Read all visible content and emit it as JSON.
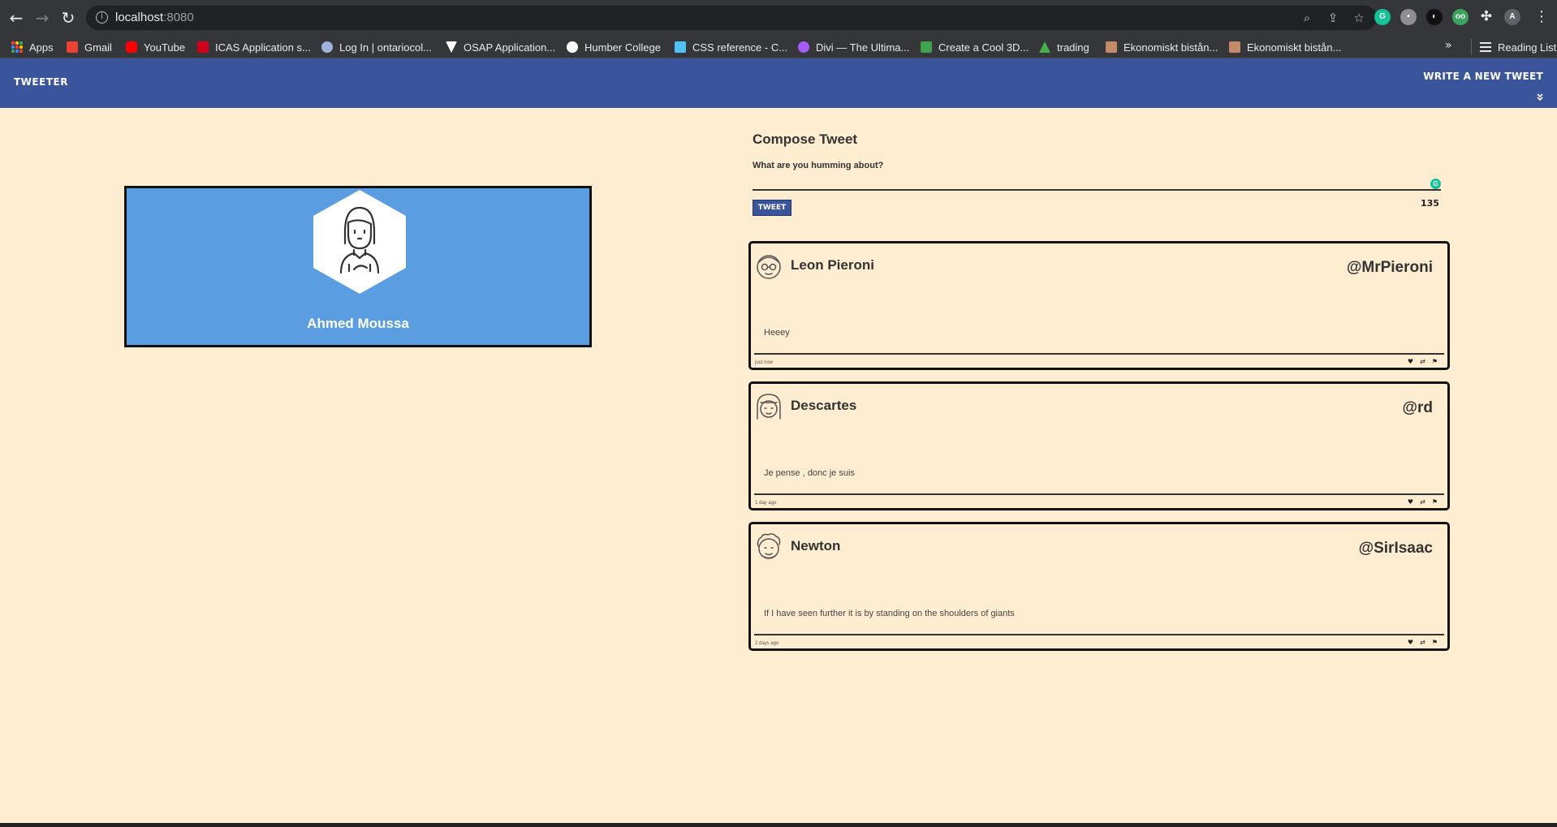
{
  "browser": {
    "url_host": "localhost",
    "url_port": ":8080",
    "bookmarks": [
      {
        "label": "Apps",
        "icon": "apps-grid-icon"
      },
      {
        "label": "Gmail",
        "icon": "gmail-icon",
        "color": "#ea4335"
      },
      {
        "label": "YouTube",
        "icon": "youtube-icon",
        "color": "#ff0000"
      },
      {
        "label": "ICAS Application s...",
        "icon": "maple-leaf-icon",
        "color": "#d0021b"
      },
      {
        "label": "Log In | ontariocol...",
        "icon": "ontariocol-icon",
        "color": "#9fb4d9"
      },
      {
        "label": "OSAP Application...",
        "icon": "osap-icon",
        "color": "#ffffff"
      },
      {
        "label": "Humber College",
        "icon": "humber-icon",
        "color": "#ffffff"
      },
      {
        "label": "CSS reference - C...",
        "icon": "css-tricks-icon",
        "color": "#4fc3f7"
      },
      {
        "label": "Divi — The Ultima...",
        "icon": "divi-icon",
        "color": "#a45cf5"
      },
      {
        "label": "Create a Cool 3D...",
        "icon": "envato-icon",
        "color": "#3fa34d"
      },
      {
        "label": "trading",
        "icon": "tradingview-icon",
        "color": "#46b04a"
      },
      {
        "label": "Ekonomiskt bistån...",
        "icon": "ekonomiskt-icon",
        "color": "#c48a6a"
      },
      {
        "label": "Ekonomiskt bistån...",
        "icon": "ekonomiskt-icon",
        "color": "#c48a6a"
      }
    ],
    "reading_list": "Reading List"
  },
  "app": {
    "brand": "Tweeter",
    "write_new": "Write a new tweet",
    "profile": {
      "name": "Ahmed Moussa",
      "avatar_icon": "user-avatar-icon"
    },
    "compose": {
      "title": "Compose Tweet",
      "label": "What are you humming about?",
      "value": "",
      "button": "Tweet",
      "counter": "135"
    },
    "tweets": [
      {
        "name": "Leon Pieroni",
        "handle": "@MrPieroni",
        "text": "Heeey",
        "time": "just now",
        "avatar_icon": "glasses-face-icon"
      },
      {
        "name": "Descartes",
        "handle": "@rd",
        "text": "Je pense , donc je suis",
        "time": "1 day ago",
        "avatar_icon": "bob-hair-face-icon"
      },
      {
        "name": "Newton",
        "handle": "@SirIsaac",
        "text": "If I have seen further it is by standing on the shoulders of giants",
        "time": "2 days ago",
        "avatar_icon": "curly-hair-face-icon"
      }
    ]
  },
  "colors": {
    "page_bg": "#ffedd1",
    "nav_bg": "#3a559c",
    "card_bg": "#5a9de0"
  }
}
